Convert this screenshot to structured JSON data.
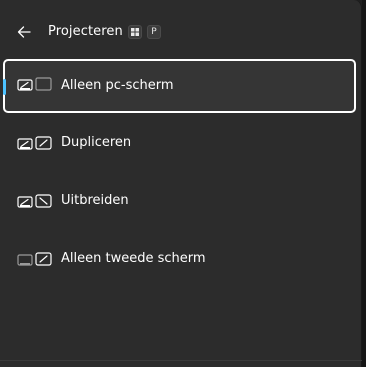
{
  "header": {
    "title": "Projecteren",
    "back_icon": "arrow-left-icon",
    "shortcut_keys": [
      "windows-logo-key",
      "P"
    ]
  },
  "options": [
    {
      "label": "Alleen pc-scherm",
      "icon": "pc-screen-only-icon",
      "selected": true
    },
    {
      "label": "Dupliceren",
      "icon": "duplicate-icon",
      "selected": false
    },
    {
      "label": "Uitbreiden",
      "icon": "extend-icon",
      "selected": false
    },
    {
      "label": "Alleen tweede scherm",
      "icon": "second-screen-only-icon",
      "selected": false
    }
  ],
  "colors": {
    "panel_background": "#2c2c2c",
    "accent": "#4cc2ff",
    "text": "#ffffff",
    "selected_background": "#353535",
    "selected_border": "#ffffff"
  }
}
